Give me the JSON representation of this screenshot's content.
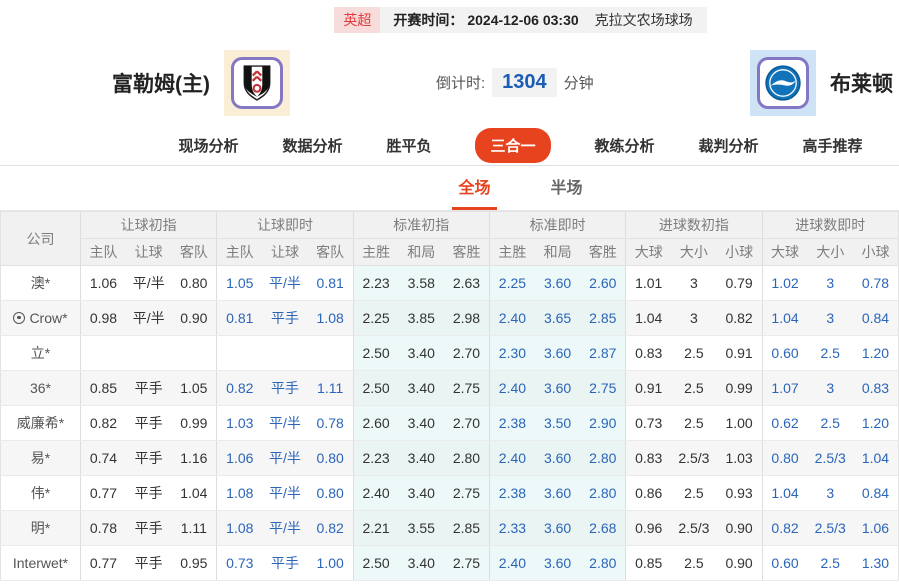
{
  "topbar": {
    "league": "英超",
    "kickoff_label": "开赛时间：",
    "kickoff_time": "2024-12-06 03:30",
    "venue": "克拉文农场球场"
  },
  "teams": {
    "home_name": "富勒姆(主)",
    "away_name": "布莱顿"
  },
  "countdown": {
    "label": "倒计时:",
    "value": "1304",
    "unit": "分钟"
  },
  "nav_tabs": [
    {
      "label": "现场分析",
      "active": false
    },
    {
      "label": "数据分析",
      "active": false
    },
    {
      "label": "胜平负",
      "active": false
    },
    {
      "label": "三合一",
      "active": true
    },
    {
      "label": "教练分析",
      "active": false
    },
    {
      "label": "裁判分析",
      "active": false
    },
    {
      "label": "高手推荐",
      "active": false
    }
  ],
  "sub_tabs": [
    {
      "label": "全场",
      "active": true
    },
    {
      "label": "半场",
      "active": false
    }
  ],
  "odds_table": {
    "company_header": "公司",
    "groups": [
      {
        "label": "让球初指",
        "cols": [
          "主队",
          "让球",
          "客队"
        ],
        "live": false,
        "cyan": false
      },
      {
        "label": "让球即时",
        "cols": [
          "主队",
          "让球",
          "客队"
        ],
        "live": true,
        "cyan": false
      },
      {
        "label": "标准初指",
        "cols": [
          "主胜",
          "和局",
          "客胜"
        ],
        "live": false,
        "cyan": true
      },
      {
        "label": "标准即时",
        "cols": [
          "主胜",
          "和局",
          "客胜"
        ],
        "live": true,
        "cyan": true
      },
      {
        "label": "进球数初指",
        "cols": [
          "大球",
          "大小",
          "小球"
        ],
        "live": false,
        "cyan": false
      },
      {
        "label": "进球数即时",
        "cols": [
          "大球",
          "大小",
          "小球"
        ],
        "live": true,
        "cyan": false
      }
    ],
    "rows": [
      {
        "company": "澳*",
        "has_icon": false,
        "cells": [
          "1.06",
          "平/半",
          "0.80",
          "1.05",
          "平/半",
          "0.81",
          "2.23",
          "3.58",
          "2.63",
          "2.25",
          "3.60",
          "2.60",
          "1.01",
          "3",
          "0.79",
          "1.02",
          "3",
          "0.78"
        ]
      },
      {
        "company": "Crow*",
        "has_icon": true,
        "cells": [
          "0.98",
          "平/半",
          "0.90",
          "0.81",
          "平手",
          "1.08",
          "2.25",
          "3.85",
          "2.98",
          "2.40",
          "3.65",
          "2.85",
          "1.04",
          "3",
          "0.82",
          "1.04",
          "3",
          "0.84"
        ]
      },
      {
        "company": "立*",
        "has_icon": false,
        "cells": [
          "",
          "",
          "",
          "",
          "",
          "",
          "2.50",
          "3.40",
          "2.70",
          "2.30",
          "3.60",
          "2.87",
          "0.83",
          "2.5",
          "0.91",
          "0.60",
          "2.5",
          "1.20"
        ]
      },
      {
        "company": "36*",
        "has_icon": false,
        "cells": [
          "0.85",
          "平手",
          "1.05",
          "0.82",
          "平手",
          "1.11",
          "2.50",
          "3.40",
          "2.75",
          "2.40",
          "3.60",
          "2.75",
          "0.91",
          "2.5",
          "0.99",
          "1.07",
          "3",
          "0.83"
        ]
      },
      {
        "company": "威廉希*",
        "has_icon": false,
        "cells": [
          "0.82",
          "平手",
          "0.99",
          "1.03",
          "平/半",
          "0.78",
          "2.60",
          "3.40",
          "2.70",
          "2.38",
          "3.50",
          "2.90",
          "0.73",
          "2.5",
          "1.00",
          "0.62",
          "2.5",
          "1.20"
        ]
      },
      {
        "company": "易*",
        "has_icon": false,
        "cells": [
          "0.74",
          "平手",
          "1.16",
          "1.06",
          "平/半",
          "0.80",
          "2.23",
          "3.40",
          "2.80",
          "2.40",
          "3.60",
          "2.80",
          "0.83",
          "2.5/3",
          "1.03",
          "0.80",
          "2.5/3",
          "1.04"
        ]
      },
      {
        "company": "伟*",
        "has_icon": false,
        "cells": [
          "0.77",
          "平手",
          "1.04",
          "1.08",
          "平/半",
          "0.80",
          "2.40",
          "3.40",
          "2.75",
          "2.38",
          "3.60",
          "2.80",
          "0.86",
          "2.5",
          "0.93",
          "1.04",
          "3",
          "0.84"
        ]
      },
      {
        "company": "明*",
        "has_icon": false,
        "cells": [
          "0.78",
          "平手",
          "1.11",
          "1.08",
          "平/半",
          "0.82",
          "2.21",
          "3.55",
          "2.85",
          "2.33",
          "3.60",
          "2.68",
          "0.96",
          "2.5/3",
          "0.90",
          "0.82",
          "2.5/3",
          "1.06"
        ]
      },
      {
        "company": "Interwet*",
        "has_icon": false,
        "cells": [
          "0.77",
          "平手",
          "0.95",
          "0.73",
          "平手",
          "1.00",
          "2.50",
          "3.40",
          "2.75",
          "2.40",
          "3.60",
          "2.80",
          "0.85",
          "2.5",
          "0.90",
          "0.60",
          "2.5",
          "1.30"
        ]
      }
    ]
  },
  "colors": {
    "accent_orange": "#e8431f",
    "live_blue": "#2b65b8",
    "countdown_blue": "#1c5cb5",
    "league_red": "#e23b3b",
    "league_bg": "#f8dbdb",
    "cyan_column_bg": "#ecf9f8",
    "badge_border_purple": "#8478c4"
  }
}
